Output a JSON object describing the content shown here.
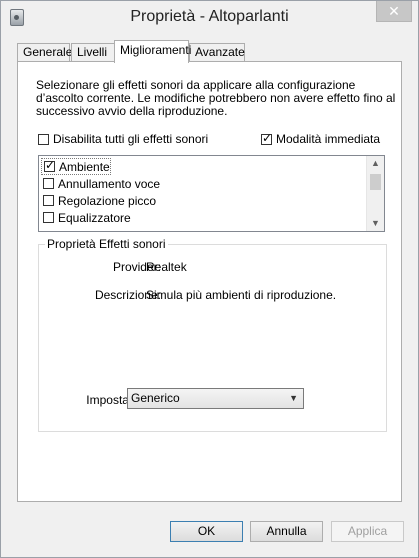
{
  "window": {
    "title": "Proprietà - Altoparlanti",
    "close_label": "✕"
  },
  "tabs": [
    {
      "label": "Generale",
      "active": false
    },
    {
      "label": "Livelli",
      "active": false
    },
    {
      "label": "Miglioramenti",
      "active": true
    },
    {
      "label": "Avanzate",
      "active": false
    }
  ],
  "panel": {
    "description": "Selezionare gli effetti sonori da applicare alla configurazione d’ascolto corrente. Le modifiche potrebbero non avere effetto fino al successivo avvio della riproduzione.",
    "disable_all_label": "Disabilita tutti gli effetti sonori",
    "immediate_mode_label": "Modalità immediata",
    "effects": [
      {
        "label": "Ambiente",
        "checked": true
      },
      {
        "label": "Annullamento voce",
        "checked": false
      },
      {
        "label": "Regolazione picco",
        "checked": false
      },
      {
        "label": "Equalizzatore",
        "checked": false
      }
    ],
    "group": {
      "title": "Proprietà Effetti sonori",
      "provider_label": "Provider:",
      "provider_value": "Realtek",
      "description_label": "Descrizione:",
      "description_value": "Simula più ambienti di riproduzione.",
      "setting_label": "Impostazione:",
      "setting_value": "Generico"
    }
  },
  "buttons": {
    "ok": "OK",
    "cancel": "Annulla",
    "apply": "Applica"
  }
}
